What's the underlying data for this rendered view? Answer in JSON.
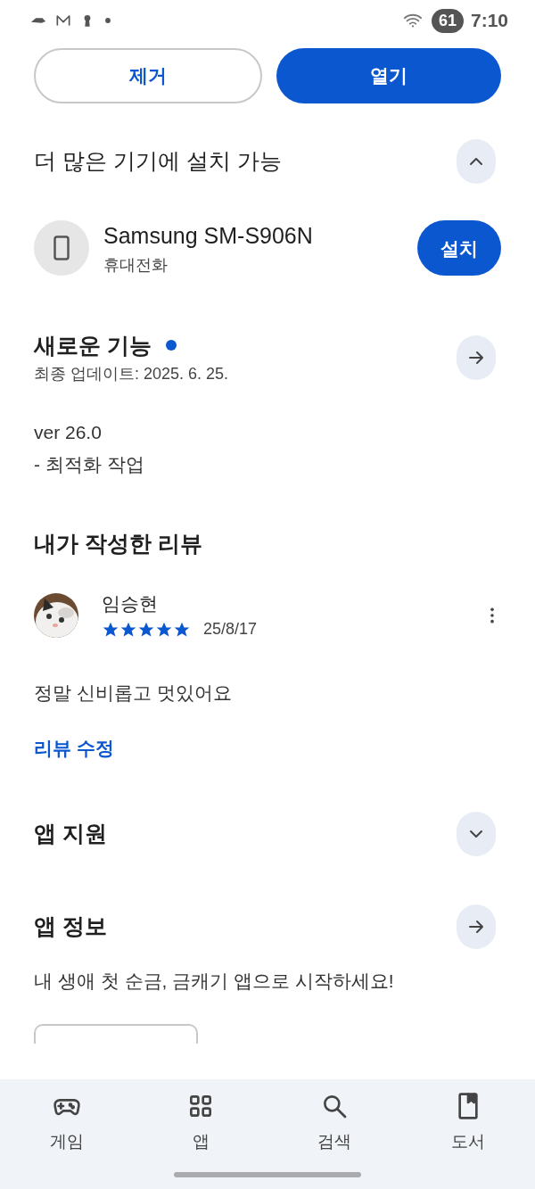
{
  "status_bar": {
    "time": "7:10",
    "battery": "61"
  },
  "actions": [
    {
      "label": "제거",
      "kind": "outline"
    },
    {
      "label": "열기",
      "kind": "filled"
    }
  ],
  "more_devices": {
    "title": "더 많은 기기에 설치 가능",
    "expanded": true,
    "device": {
      "name": "Samsung SM-S906N",
      "type": "휴대전화",
      "button": "설치"
    }
  },
  "whats_new": {
    "title": "새로운 기능",
    "new": true,
    "updated": "최종 업데이트: 2025. 6. 25.",
    "lines": [
      "ver 26.0",
      "- 최적화 작업"
    ]
  },
  "my_review": {
    "title": "내가 작성한 리뷰",
    "author": "임승현",
    "stars": 5,
    "date": "25/8/17",
    "text": "정말 신비롭고 멋있어요",
    "edit": "리뷰 수정"
  },
  "app_support": {
    "title": "앱 지원",
    "expanded": false
  },
  "app_info": {
    "title": "앱 정보",
    "description": "내 생애 첫 순금, 금캐기 앱으로 시작하세요!"
  },
  "bottom_nav": [
    {
      "label": "게임",
      "kind": "game",
      "selected": false
    },
    {
      "label": "앱",
      "kind": "apps",
      "selected": false
    },
    {
      "label": "검색",
      "kind": "search",
      "selected": false
    },
    {
      "label": "도서",
      "kind": "book",
      "selected": false
    }
  ]
}
